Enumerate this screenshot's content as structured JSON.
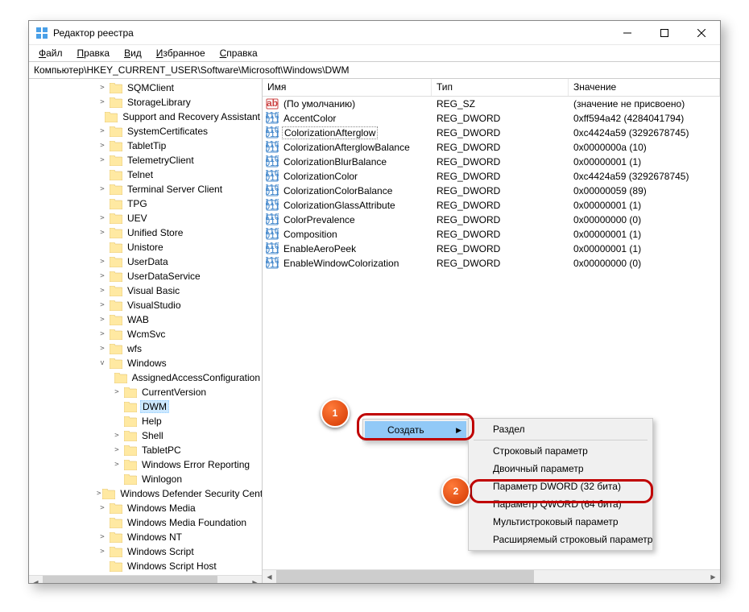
{
  "window": {
    "title": "Редактор реестра"
  },
  "menubar": {
    "file": "Файл",
    "edit": "Правка",
    "view": "Вид",
    "favorites": "Избранное",
    "help": "Справка"
  },
  "address": "Компьютер\\HKEY_CURRENT_USER\\Software\\Microsoft\\Windows\\DWM",
  "tree": [
    {
      "expander": "collapsed",
      "label": "SQMClient",
      "depth": 1
    },
    {
      "expander": "collapsed",
      "label": "StorageLibrary",
      "depth": 1
    },
    {
      "expander": "",
      "label": "Support and Recovery Assistant",
      "depth": 1
    },
    {
      "expander": "collapsed",
      "label": "SystemCertificates",
      "depth": 1
    },
    {
      "expander": "collapsed",
      "label": "TabletTip",
      "depth": 1
    },
    {
      "expander": "collapsed",
      "label": "TelemetryClient",
      "depth": 1
    },
    {
      "expander": "",
      "label": "Telnet",
      "depth": 1
    },
    {
      "expander": "collapsed",
      "label": "Terminal Server Client",
      "depth": 1
    },
    {
      "expander": "",
      "label": "TPG",
      "depth": 1
    },
    {
      "expander": "collapsed",
      "label": "UEV",
      "depth": 1
    },
    {
      "expander": "collapsed",
      "label": "Unified Store",
      "depth": 1
    },
    {
      "expander": "",
      "label": "Unistore",
      "depth": 1
    },
    {
      "expander": "collapsed",
      "label": "UserData",
      "depth": 1
    },
    {
      "expander": "collapsed",
      "label": "UserDataService",
      "depth": 1
    },
    {
      "expander": "collapsed",
      "label": "Visual Basic",
      "depth": 1
    },
    {
      "expander": "collapsed",
      "label": "VisualStudio",
      "depth": 1
    },
    {
      "expander": "collapsed",
      "label": "WAB",
      "depth": 1
    },
    {
      "expander": "collapsed",
      "label": "WcmSvc",
      "depth": 1
    },
    {
      "expander": "collapsed",
      "label": "wfs",
      "depth": 1
    },
    {
      "expander": "expanded",
      "label": "Windows",
      "depth": 1
    },
    {
      "expander": "",
      "label": "AssignedAccessConfiguration",
      "depth": 2
    },
    {
      "expander": "collapsed",
      "label": "CurrentVersion",
      "depth": 2
    },
    {
      "expander": "",
      "label": "DWM",
      "depth": 2,
      "selected": true
    },
    {
      "expander": "",
      "label": "Help",
      "depth": 2
    },
    {
      "expander": "collapsed",
      "label": "Shell",
      "depth": 2
    },
    {
      "expander": "collapsed",
      "label": "TabletPC",
      "depth": 2
    },
    {
      "expander": "collapsed",
      "label": "Windows Error Reporting",
      "depth": 2
    },
    {
      "expander": "",
      "label": "Winlogon",
      "depth": 2
    },
    {
      "expander": "collapsed",
      "label": "Windows Defender Security Center",
      "depth": 1
    },
    {
      "expander": "collapsed",
      "label": "Windows Media",
      "depth": 1
    },
    {
      "expander": "",
      "label": "Windows Media Foundation",
      "depth": 1
    },
    {
      "expander": "collapsed",
      "label": "Windows NT",
      "depth": 1
    },
    {
      "expander": "collapsed",
      "label": "Windows Script",
      "depth": 1
    },
    {
      "expander": "",
      "label": "Windows Script Host",
      "depth": 1
    }
  ],
  "list": {
    "headers": {
      "name": "Имя",
      "type": "Тип",
      "value": "Значение"
    },
    "rows": [
      {
        "icon": "string",
        "name": "(По умолчанию)",
        "type": "REG_SZ",
        "value": "(значение не присвоено)"
      },
      {
        "icon": "binary",
        "name": "AccentColor",
        "type": "REG_DWORD",
        "value": "0xff594a42 (4284041794)"
      },
      {
        "icon": "binary",
        "name": "ColorizationAfterglow",
        "type": "REG_DWORD",
        "value": "0xc4424a59 (3292678745)",
        "focused": true
      },
      {
        "icon": "binary",
        "name": "ColorizationAfterglowBalance",
        "type": "REG_DWORD",
        "value": "0x0000000a (10)"
      },
      {
        "icon": "binary",
        "name": "ColorizationBlurBalance",
        "type": "REG_DWORD",
        "value": "0x00000001 (1)"
      },
      {
        "icon": "binary",
        "name": "ColorizationColor",
        "type": "REG_DWORD",
        "value": "0xc4424a59 (3292678745)"
      },
      {
        "icon": "binary",
        "name": "ColorizationColorBalance",
        "type": "REG_DWORD",
        "value": "0x00000059 (89)"
      },
      {
        "icon": "binary",
        "name": "ColorizationGlassAttribute",
        "type": "REG_DWORD",
        "value": "0x00000001 (1)"
      },
      {
        "icon": "binary",
        "name": "ColorPrevalence",
        "type": "REG_DWORD",
        "value": "0x00000000 (0)"
      },
      {
        "icon": "binary",
        "name": "Composition",
        "type": "REG_DWORD",
        "value": "0x00000001 (1)"
      },
      {
        "icon": "binary",
        "name": "EnableAeroPeek",
        "type": "REG_DWORD",
        "value": "0x00000001 (1)"
      },
      {
        "icon": "binary",
        "name": "EnableWindowColorization",
        "type": "REG_DWORD",
        "value": "0x00000000 (0)"
      }
    ]
  },
  "context_menu": {
    "create": "Создать",
    "submenu": {
      "section": "Раздел",
      "string": "Строковый параметр",
      "binary": "Двоичный параметр",
      "dword": "Параметр DWORD (32 бита)",
      "qword": "Параметр QWORD (64 бита)",
      "multistring": "Мультистроковый параметр",
      "expandstring": "Расширяемый строковый параметр"
    }
  },
  "callouts": {
    "one": "1",
    "two": "2"
  }
}
